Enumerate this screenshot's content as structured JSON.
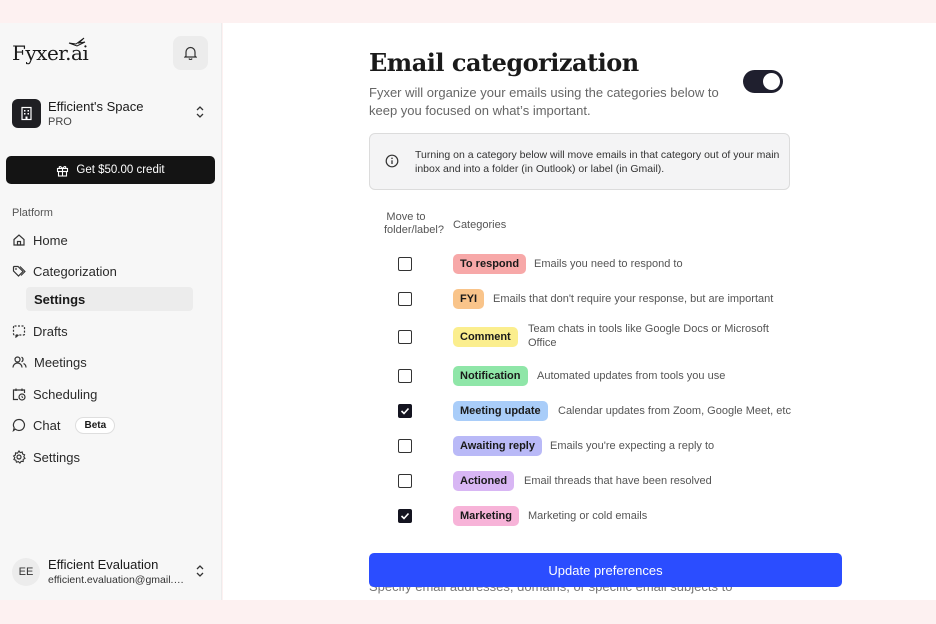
{
  "app": {
    "logo": "Fyxer.ai"
  },
  "space": {
    "name": "Efficient's Space",
    "plan": "PRO"
  },
  "credit_button": "Get $50.00 credit",
  "sidebar": {
    "section_label": "Platform",
    "items": [
      {
        "label": "Home",
        "icon": "home-icon"
      },
      {
        "label": "Categorization",
        "icon": "tag-icon"
      },
      {
        "label": "Drafts",
        "icon": "drafts-icon"
      },
      {
        "label": "Meetings",
        "icon": "users-icon"
      },
      {
        "label": "Scheduling",
        "icon": "calendar-clock-icon"
      },
      {
        "label": "Chat",
        "icon": "chat-icon",
        "badge": "Beta"
      },
      {
        "label": "Settings",
        "icon": "gear-icon"
      }
    ],
    "subitem": "Settings"
  },
  "user": {
    "initials": "EE",
    "name": "Efficient Evaluation",
    "email": "efficient.evaluation@gmail.com"
  },
  "main": {
    "title": "Email categorization",
    "subtitle": "Fyxer will organize your emails using the categories below to keep you focused on what’s important.",
    "toggle_on": true,
    "info": "Turning on a category below will move emails in that category out of your main inbox and into a folder (in Outlook) or label (in Gmail).",
    "col_move": "Move to folder/label?",
    "col_categories": "Categories",
    "categories": [
      {
        "label": "To respond",
        "desc": "Emails you need to respond to",
        "checked": false,
        "color": "#f7a8a8"
      },
      {
        "label": "FYI",
        "desc": "Emails that don't require your response, but are important",
        "checked": false,
        "color": "#f9c48a"
      },
      {
        "label": "Comment",
        "desc": "Team chats in tools like Google Docs or Microsoft Office",
        "checked": false,
        "color": "#fbee8e"
      },
      {
        "label": "Notification",
        "desc": "Automated updates from tools you use",
        "checked": false,
        "color": "#8fe6a8"
      },
      {
        "label": "Meeting update",
        "desc": "Calendar updates from Zoom, Google Meet, etc",
        "checked": true,
        "color": "#a9cdf9"
      },
      {
        "label": "Awaiting reply",
        "desc": "Emails you're expecting a reply to",
        "checked": false,
        "color": "#b9b9f7"
      },
      {
        "label": "Actioned",
        "desc": "Email threads that have been resolved",
        "checked": false,
        "color": "#d8b6f4"
      },
      {
        "label": "Marketing",
        "desc": "Marketing or cold emails",
        "checked": true,
        "color": "#f7b3d8"
      }
    ],
    "update_button": "Update preferences",
    "behind_text": "Specify email addresses, domains, or specific email subjects to"
  }
}
